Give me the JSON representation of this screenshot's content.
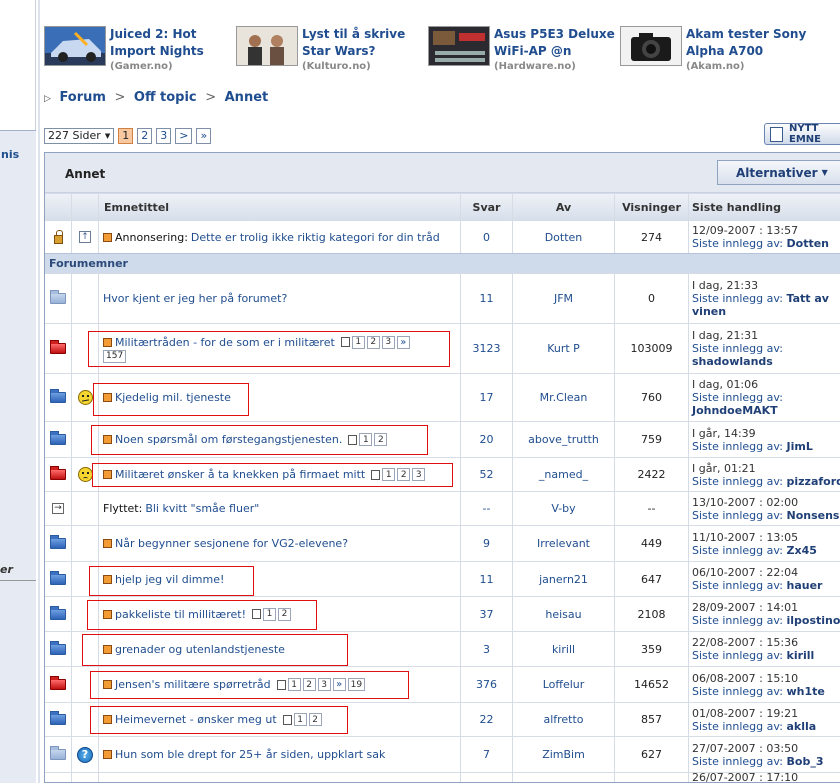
{
  "sidebar_fragments": {
    "top": "nis",
    "bottom": "er"
  },
  "news": [
    {
      "title": "Juiced 2: Hot Import Nights",
      "source": "(Gamer.no)",
      "thumb": "car"
    },
    {
      "title": "Lyst til å skrive Star Wars?",
      "source": "(Kulturo.no)",
      "thumb": "people"
    },
    {
      "title": "Asus P5E3 Deluxe WiFi-AP @n",
      "source": "(Hardware.no)",
      "thumb": "board"
    },
    {
      "title": "Akam tester Sony Alpha A700",
      "source": "(Akam.no)",
      "thumb": "camera"
    }
  ],
  "breadcrumb": {
    "items": [
      "Forum",
      "Off topic",
      "Annet"
    ],
    "sep": ">"
  },
  "pager": {
    "select": "227 Sider",
    "pages": [
      "1",
      "2",
      "3",
      ">",
      "»"
    ],
    "current": "1"
  },
  "new_topic_button": "NYTT EMNE",
  "forum": {
    "title": "Annet",
    "options_button": "Alternativer",
    "columns": {
      "title": "Emnetittel",
      "replies": "Svar",
      "author": "Av",
      "views": "Visninger",
      "last": "Siste handling"
    },
    "announcement": {
      "prefix": "Annonsering:",
      "title": "Dette er trolig ikke riktig kategori for din tråd",
      "replies": "0",
      "author": "Dotten",
      "views": "274",
      "last_date": "12/09-2007 : 13:57",
      "last_by_label": "Siste innlegg av:",
      "last_by": "Dotten"
    },
    "section_label": "Forumemner",
    "topics": [
      {
        "title": "Hvor kjent er jeg her på forumet?",
        "prefix": "",
        "pages": [],
        "more": "",
        "last_page": "",
        "replies": "11",
        "author": "JFM",
        "views": "0",
        "last_date": "I dag, 21:33",
        "last_by_label": "Siste innlegg av:",
        "last_by": "Tatt av vinen"
      },
      {
        "title": "Militærtråden - for de som er i militæret",
        "prefix": "",
        "pages": [
          "1",
          "2",
          "3"
        ],
        "more": "»",
        "last_page": "157",
        "replies": "3123",
        "author": "Kurt P",
        "views": "103009",
        "last_date": "I dag, 21:31",
        "last_by_label": "Siste innlegg av:",
        "last_by": "shadowlands"
      },
      {
        "title": "Kjedelig mil. tjeneste",
        "prefix": "",
        "pages": [],
        "more": "",
        "last_page": "",
        "replies": "17",
        "author": "Mr.Clean",
        "views": "760",
        "last_date": "I dag, 01:06",
        "last_by_label": "Siste innlegg av:",
        "last_by": "JohndoeMAKT"
      },
      {
        "title": "Noen spørsmål om førstegangstjenesten.",
        "prefix": "",
        "pages": [
          "1",
          "2"
        ],
        "more": "",
        "last_page": "",
        "replies": "20",
        "author": "above_trutth",
        "views": "759",
        "last_date": "I går, 14:39",
        "last_by_label": "Siste innlegg av:",
        "last_by": "JimL"
      },
      {
        "title": "Militæret ønsker å ta knekken på firmaet mitt",
        "prefix": "",
        "pages": [
          "1",
          "2",
          "3"
        ],
        "more": "",
        "last_page": "",
        "replies": "52",
        "author": "_named_",
        "views": "2422",
        "last_date": "I går, 01:21",
        "last_by_label": "Siste innlegg av:",
        "last_by": "pizzaford"
      },
      {
        "title": "Bli kvitt \"småe fluer\"",
        "prefix": "Flyttet:",
        "pages": [],
        "more": "",
        "last_page": "",
        "replies": "--",
        "author": "V-by",
        "views": "--",
        "last_date": "13/10-2007 : 02:00",
        "last_by_label": "Siste innlegg av:",
        "last_by": "Nonsens"
      },
      {
        "title": "Når begynner sesjonene for VG2-elevene?",
        "prefix": "",
        "pages": [],
        "more": "",
        "last_page": "",
        "replies": "9",
        "author": "Irrelevant",
        "views": "449",
        "last_date": "11/10-2007 : 13:05",
        "last_by_label": "Siste innlegg av:",
        "last_by": "Zx45"
      },
      {
        "title": "hjelp jeg vil dimme!",
        "prefix": "",
        "pages": [],
        "more": "",
        "last_page": "",
        "replies": "11",
        "author": "janern21",
        "views": "647",
        "last_date": "06/10-2007 : 22:04",
        "last_by_label": "Siste innlegg av:",
        "last_by": "hauer"
      },
      {
        "title": "pakkeliste til millitæret!",
        "prefix": "",
        "pages": [
          "1",
          "2"
        ],
        "more": "",
        "last_page": "",
        "replies": "37",
        "author": "heisau",
        "views": "2108",
        "last_date": "28/09-2007 : 14:01",
        "last_by_label": "Siste innlegg av:",
        "last_by": "ilpostino"
      },
      {
        "title": "grenader og utenlandstjeneste",
        "prefix": "",
        "pages": [],
        "more": "",
        "last_page": "",
        "replies": "3",
        "author": "kirill",
        "views": "359",
        "last_date": "22/08-2007 : 15:36",
        "last_by_label": "Siste innlegg av:",
        "last_by": "kirill"
      },
      {
        "title": "Jensen's militære spørretråd",
        "prefix": "",
        "pages": [
          "1",
          "2",
          "3"
        ],
        "more": "»",
        "last_page": "19",
        "replies": "376",
        "author": "Loffelur",
        "views": "14652",
        "last_date": "06/08-2007 : 15:10",
        "last_by_label": "Siste innlegg av:",
        "last_by": "wh1te"
      },
      {
        "title": "Heimevernet - ønsker meg ut",
        "prefix": "",
        "pages": [
          "1",
          "2"
        ],
        "more": "",
        "last_page": "",
        "replies": "22",
        "author": "alfretto",
        "views": "857",
        "last_date": "01/08-2007 : 19:21",
        "last_by_label": "Siste innlegg av:",
        "last_by": "aklla"
      },
      {
        "title": "Hun som ble drept for 25+ år siden, uppklart sak",
        "prefix": "",
        "pages": [],
        "more": "",
        "last_page": "",
        "replies": "7",
        "author": "ZimBim",
        "views": "627",
        "last_date": "27/07-2007 : 03:50",
        "last_by_label": "Siste innlegg av:",
        "last_by": "Bob_3"
      }
    ],
    "partial_last_date": "26/07-2007 : 17:10"
  },
  "colors": {
    "link": "#1f4d8f",
    "section_bg": "#cfdaea",
    "highlight_box": "#e01010"
  }
}
